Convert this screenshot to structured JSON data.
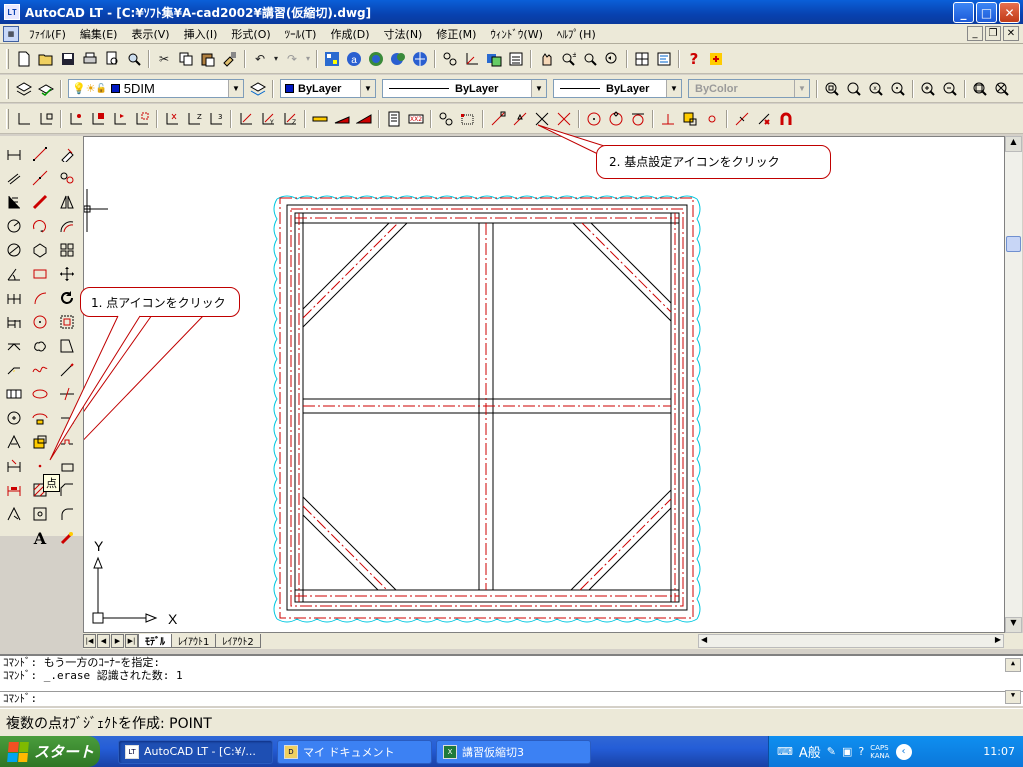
{
  "window": {
    "title": "AutoCAD LT - [C:¥ｿﾌﾄ集¥A-cad2002¥講習(仮縮切).dwg]",
    "app_icon": "LT"
  },
  "menu": {
    "items": [
      "ﾌｧｲﾙ(F)",
      "編集(E)",
      "表示(V)",
      "挿入(I)",
      "形式(O)",
      "ﾂｰﾙ(T)",
      "作成(D)",
      "寸法(N)",
      "修正(M)",
      "ｳｨﾝﾄﾞｳ(W)",
      "ﾍﾙﾌﾟ(H)"
    ]
  },
  "layers": {
    "current_layer": "5DIM",
    "color": "ByLayer",
    "linetype": "ByLayer",
    "lineweight": "ByLayer",
    "plotstyle": "ByColor"
  },
  "callouts": {
    "point_icon": "1. 点アイコンをクリック",
    "base_point_icon": "2. 基点設定アイコンをクリック"
  },
  "tooltip": {
    "text": "点"
  },
  "ucs": {
    "x": "X",
    "y": "Y"
  },
  "layout_tabs": [
    "ﾓﾃﾞﾙ",
    "ﾚｲｱｳﾄ1",
    "ﾚｲｱｳﾄ2"
  ],
  "command": {
    "lines": [
      "ｺﾏﾝﾄﾞ: もう一方のｺｰﾅｰを指定:",
      "ｺﾏﾝﾄﾞ: _.erase 認識された数: 1",
      "ｺﾏﾝﾄﾞ:"
    ]
  },
  "status": {
    "text": "複数の点ｵﾌﾞｼﾞｪｸﾄを作成:  POINT"
  },
  "taskbar": {
    "start_label": "スタート",
    "tasks": [
      {
        "label": "AutoCAD LT - [C:¥/...",
        "icon": "LT"
      },
      {
        "label": "マイ ドキュメント",
        "icon": "D"
      },
      {
        "label": "講習仮縮切3",
        "icon": "X"
      }
    ],
    "ime": "A般",
    "caps": "CAPS",
    "kana": "KANA",
    "clock": "11:07"
  },
  "colors": {
    "accent": "#0842b0",
    "red": "#cc0000",
    "cyan": "#00c8e0"
  }
}
